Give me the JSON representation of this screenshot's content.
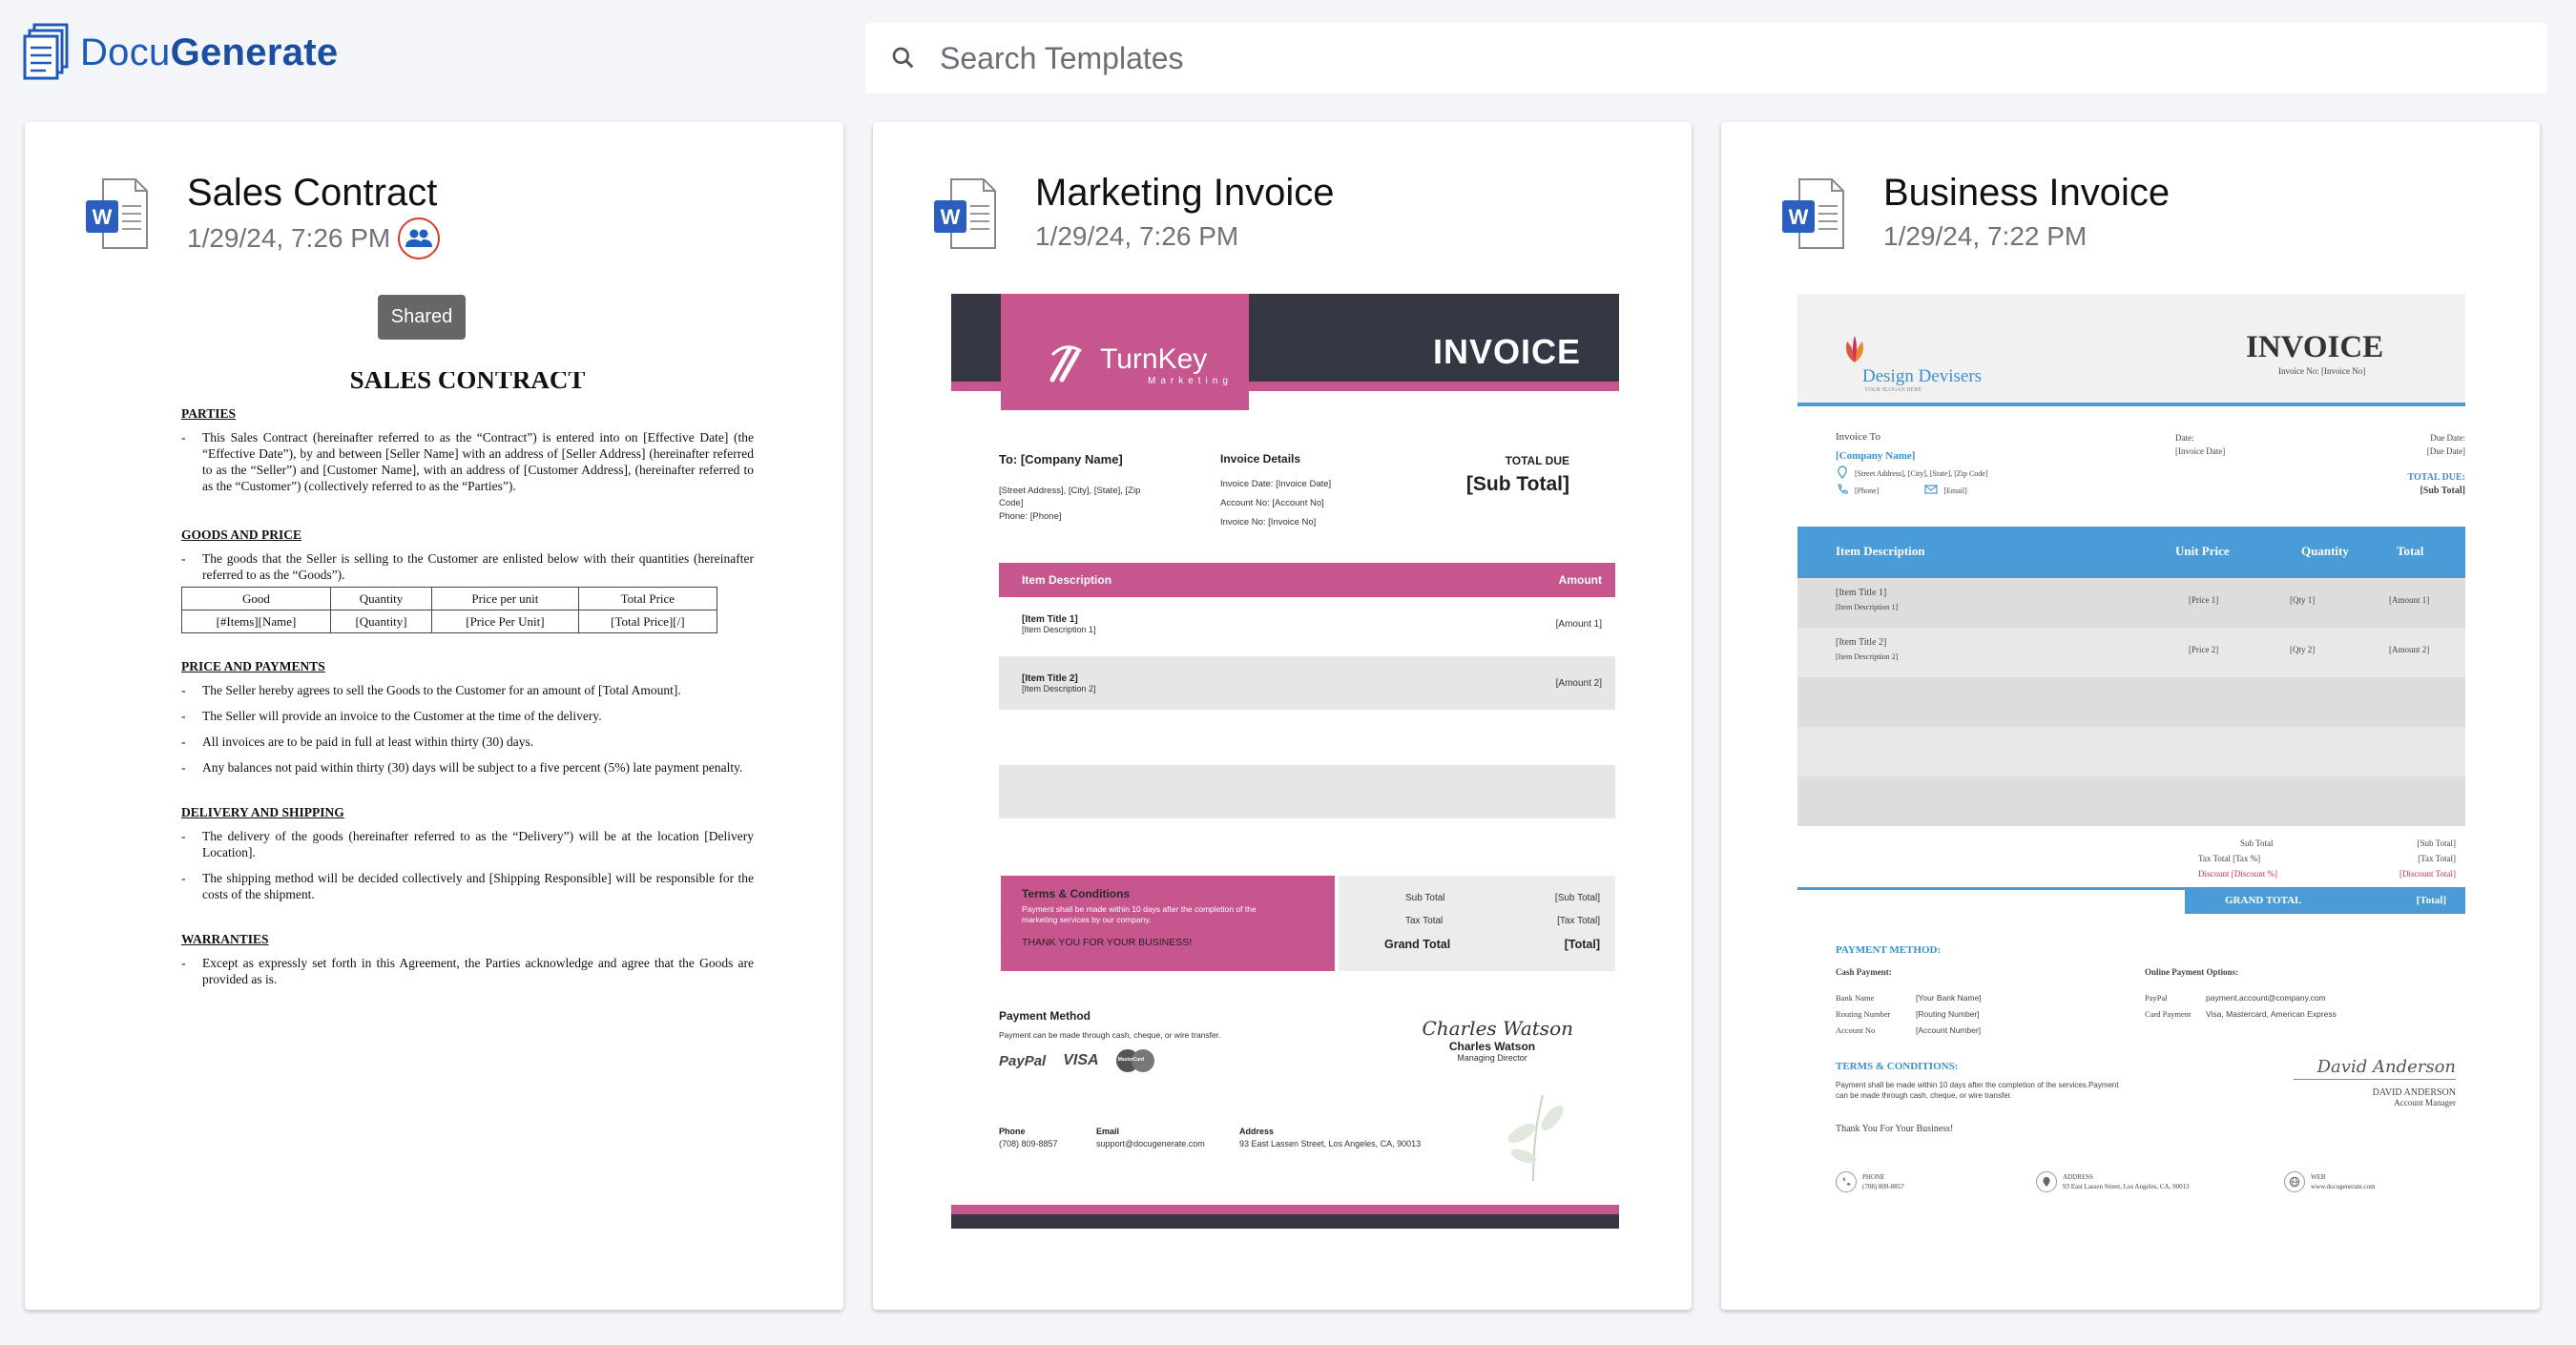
{
  "app": {
    "brand_light": "Docu",
    "brand_bold": "Generate"
  },
  "search": {
    "placeholder": "Search Templates"
  },
  "cards": [
    {
      "title": "Sales Contract",
      "date": "1/29/24, 7:26 PM",
      "shared": true,
      "tooltip": "Shared"
    },
    {
      "title": "Marketing Invoice",
      "date": "1/29/24, 7:26 PM"
    },
    {
      "title": "Business Invoice",
      "date": "1/29/24, 7:22 PM"
    }
  ],
  "contract": {
    "heading": "SALES CONTRACT",
    "parties_h": "PARTIES",
    "parties_p": "This Sales Contract (hereinafter referred to as the “Contract”) is entered into on [Effective Date] (the “Effective Date”), by and between [Seller Name] with an address of [Seller Address] (hereinafter referred to as the “Seller”) and [Customer Name], with an address of [Customer Address], (hereinafter referred to as the “Customer”) (collectively referred to as the “Parties”).",
    "goods_h": "GOODS AND PRICE",
    "goods_p": "The goods that the Seller is selling to the Customer are enlisted below with their quantities (hereinafter referred to as the “Goods”).",
    "table_head": [
      "Good",
      "Quantity",
      "Price per unit",
      "Total Price"
    ],
    "table_row": [
      "[#Items][Name]",
      "[Quantity]",
      "[Price Per Unit]",
      "[Total Price][/]"
    ],
    "price_h": "PRICE AND PAYMENTS",
    "price_items": [
      "The Seller hereby agrees to sell the Goods to the Customer for an amount of [Total Amount].",
      "The Seller will provide an invoice to the Customer at the time of the delivery.",
      "All invoices are to be paid in full at least within thirty (30) days.",
      "Any balances not paid within thirty (30) days will be subject to a five percent (5%) late payment penalty."
    ],
    "delivery_h": "DELIVERY AND SHIPPING",
    "delivery_items": [
      "The delivery of the goods (hereinafter referred to as the “Delivery”) will be at the location [Delivery Location].",
      "The shipping method will be decided collectively and [Shipping Responsible] will be responsible for the costs of the shipment."
    ],
    "warranties_h": "WARRANTIES",
    "warranties_items": [
      "Except as expressly set forth in this Agreement, the Parties acknowledge and agree that the Goods are provided as is."
    ]
  },
  "marketing": {
    "logo": "TurnKey",
    "logo_sub": "Marketing",
    "invoice": "INVOICE",
    "to": "To: [Company Name]",
    "address": "[Street Address], [City], [State], [Zip Code]",
    "phone": "Phone: [Phone]",
    "details_h": "Invoice Details",
    "details": [
      "Invoice Date: [Invoice Date]",
      "Account No: [Account No]",
      "Invoice No: [Invoice No]"
    ],
    "total_due_l": "TOTAL DUE",
    "total_due_v": "[Sub Total]",
    "col_desc": "Item Description",
    "col_amt": "Amount",
    "items": [
      {
        "title": "[Item Title 1]",
        "desc": "[Item Description 1]",
        "amount": "[Amount 1]"
      },
      {
        "title": "[Item Title 2]",
        "desc": "[Item Description 2]",
        "amount": "[Amount 2]"
      }
    ],
    "terms_h": "Terms & Conditions",
    "terms_p": "Payment shall be made within 10 days after the completion of the marketing services by our company.",
    "thanks": "THANK YOU FOR YOUR BUSINESS!",
    "sub_total_l": "Sub Total",
    "sub_total_v": "[Sub Total]",
    "tax_l": "Tax Total",
    "tax_v": "[Tax Total]",
    "grand_l": "Grand Total",
    "grand_v": "[Total]",
    "pay_h": "Payment Method",
    "pay_p": "Payment can be made through cash, cheque, or wire transfer.",
    "pay_logos": [
      "PayPal",
      "VISA",
      "MasterCard"
    ],
    "signature": "Charles Watson",
    "signer": "Charles Watson",
    "signer_role": "Managing Director",
    "phone_l": "Phone",
    "phone_v": "(708) 809-8857",
    "email_l": "Email",
    "email_v": "support@docugenerate.com",
    "addr_l": "Address",
    "addr_v": "93 East Lassen Street, Los Angeles, CA, 90013"
  },
  "business": {
    "logo": "Design Devisers",
    "logo_sub": "YOUR SLOGAN HERE",
    "invoice": "INVOICE",
    "invoice_no": "Invoice No: [Invoice No]",
    "to_l": "Invoice To",
    "company": "[Company Name]",
    "address": "[Street Address], [City], [State], [Zip Code]",
    "phone": "[Phone]",
    "email": "[Email]",
    "date_l": "Date:",
    "date_v": "[Invoice Date]",
    "due_l": "Due Date:",
    "due_v": "[Due Date]",
    "total_due_l": "TOTAL DUE:",
    "total_due_v": "[Sub Total]",
    "cols": [
      "Item Description",
      "Unit Price",
      "Quantity",
      "Total"
    ],
    "items": [
      {
        "title": "[Item Title 1]",
        "desc": "[Item Description 1]",
        "price": "[Price 1]",
        "qty": "[Qty 1]",
        "amount": "[Amount 1]"
      },
      {
        "title": "[Item Title 2]",
        "desc": "[Item Description 2]",
        "price": "[Price 2]",
        "qty": "[Qty 2]",
        "amount": "[Amount 2]"
      }
    ],
    "sub_l": "Sub Total",
    "sub_v": "[Sub Total]",
    "tax_l": "Tax Total [Tax %]",
    "tax_v": "[Tax Total]",
    "disc_l": "Discount [Discount %]",
    "disc_v": "[Discount Total]",
    "grand_l": "GRAND TOTAL",
    "grand_v": "[Total]",
    "pm_h": "PAYMENT METHOD:",
    "cash_h": "Cash Payment:",
    "bank": [
      [
        "Bank Name",
        "[Your Bank Name]"
      ],
      [
        "Routing Number",
        "[Routing Number]"
      ],
      [
        "Account No",
        "[Account Number]"
      ]
    ],
    "online_h": "Online Payment Options:",
    "online": [
      [
        "PayPal",
        "payment.account@company.com"
      ],
      [
        "Card Payment",
        "Visa, Mastercard, American Express"
      ]
    ],
    "terms_h": "TERMS & CONDITIONS:",
    "terms_p": "Payment shall be made within 10 days after the completion of the services.Payment can be made through cash, cheque, or wire transfer.",
    "thanks": "Thank You For Your Business!",
    "signature": "David Anderson",
    "signer": "DAVID ANDERSON",
    "signer_role": "Account Manager",
    "f_phone_l": "PHONE",
    "f_phone_v": "(708) 809-8857",
    "f_addr_l": "ADDRESS",
    "f_addr_v": "93 East Lassen Street, Los Angeles, CA, 90013",
    "f_web_l": "WEB",
    "f_web_v": "www.docugenerate.com"
  },
  "colors": {
    "brand": "#1e5bb8",
    "pink": "#c6568d",
    "dark": "#353843",
    "blue": "#4a9cd8",
    "share_ring": "#d93a2b"
  }
}
